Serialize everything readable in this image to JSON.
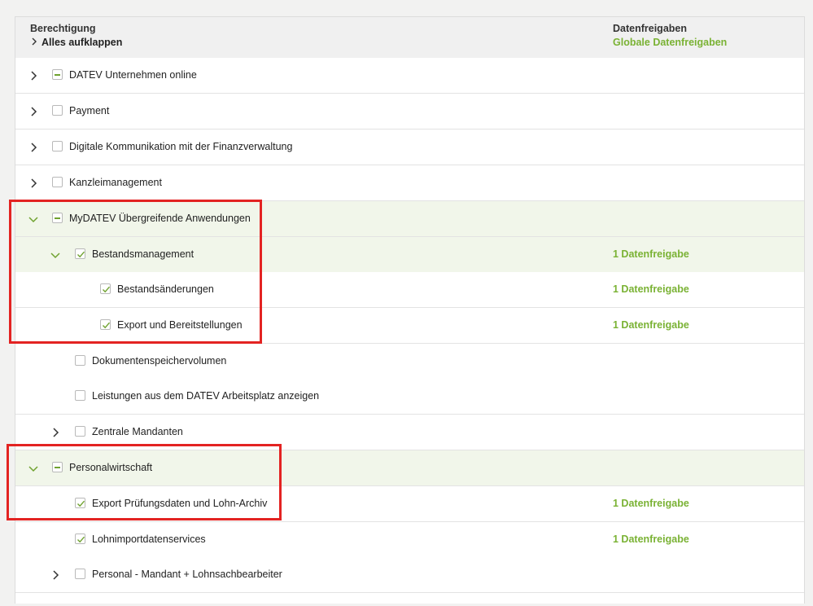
{
  "header": {
    "permission_title": "Berechtigung",
    "expand_all": "Alles aufklappen",
    "data_title": "Datenfreigaben",
    "global_data_link": "Globale Datenfreigaben"
  },
  "rows": [
    {
      "label": "DATEV Unternehmen online",
      "state": "partial",
      "expand": "collapsed"
    },
    {
      "label": "Payment",
      "state": "unchecked",
      "expand": "collapsed"
    },
    {
      "label": "Digitale Kommunikation mit der Finanzverwaltung",
      "state": "unchecked",
      "expand": "collapsed"
    },
    {
      "label": "Kanzleimanagement",
      "state": "unchecked",
      "expand": "collapsed"
    },
    {
      "label": "MyDATEV Übergreifende Anwendungen",
      "state": "partial",
      "expand": "expanded"
    },
    {
      "label": "Bestandsmanagement",
      "state": "checked",
      "expand": "expanded",
      "freigabe": "1 Datenfreigabe"
    },
    {
      "label": "Bestandsänderungen",
      "state": "checked",
      "freigabe": "1 Datenfreigabe"
    },
    {
      "label": "Export und Bereitstellungen",
      "state": "checked",
      "freigabe": "1 Datenfreigabe"
    },
    {
      "label": "Dokumentenspeichervolumen",
      "state": "unchecked"
    },
    {
      "label": "Leistungen aus dem DATEV Arbeitsplatz anzeigen",
      "state": "unchecked"
    },
    {
      "label": "Zentrale Mandanten",
      "state": "unchecked",
      "expand": "collapsed"
    },
    {
      "label": "Personalwirtschaft",
      "state": "partial",
      "expand": "expanded"
    },
    {
      "label": "Export Prüfungsdaten und Lohn-Archiv",
      "state": "checked",
      "freigabe": "1 Datenfreigabe"
    },
    {
      "label": "Lohnimportdatenservices",
      "state": "checked",
      "freigabe": "1 Datenfreigabe"
    },
    {
      "label": "Personal - Mandant + Lohnsachbearbeiter",
      "state": "unchecked",
      "expand": "collapsed"
    }
  ],
  "colors": {
    "accent_green": "#7ab234",
    "highlight_red": "#e32322",
    "expanded_row_bg": "#f1f6ea"
  }
}
